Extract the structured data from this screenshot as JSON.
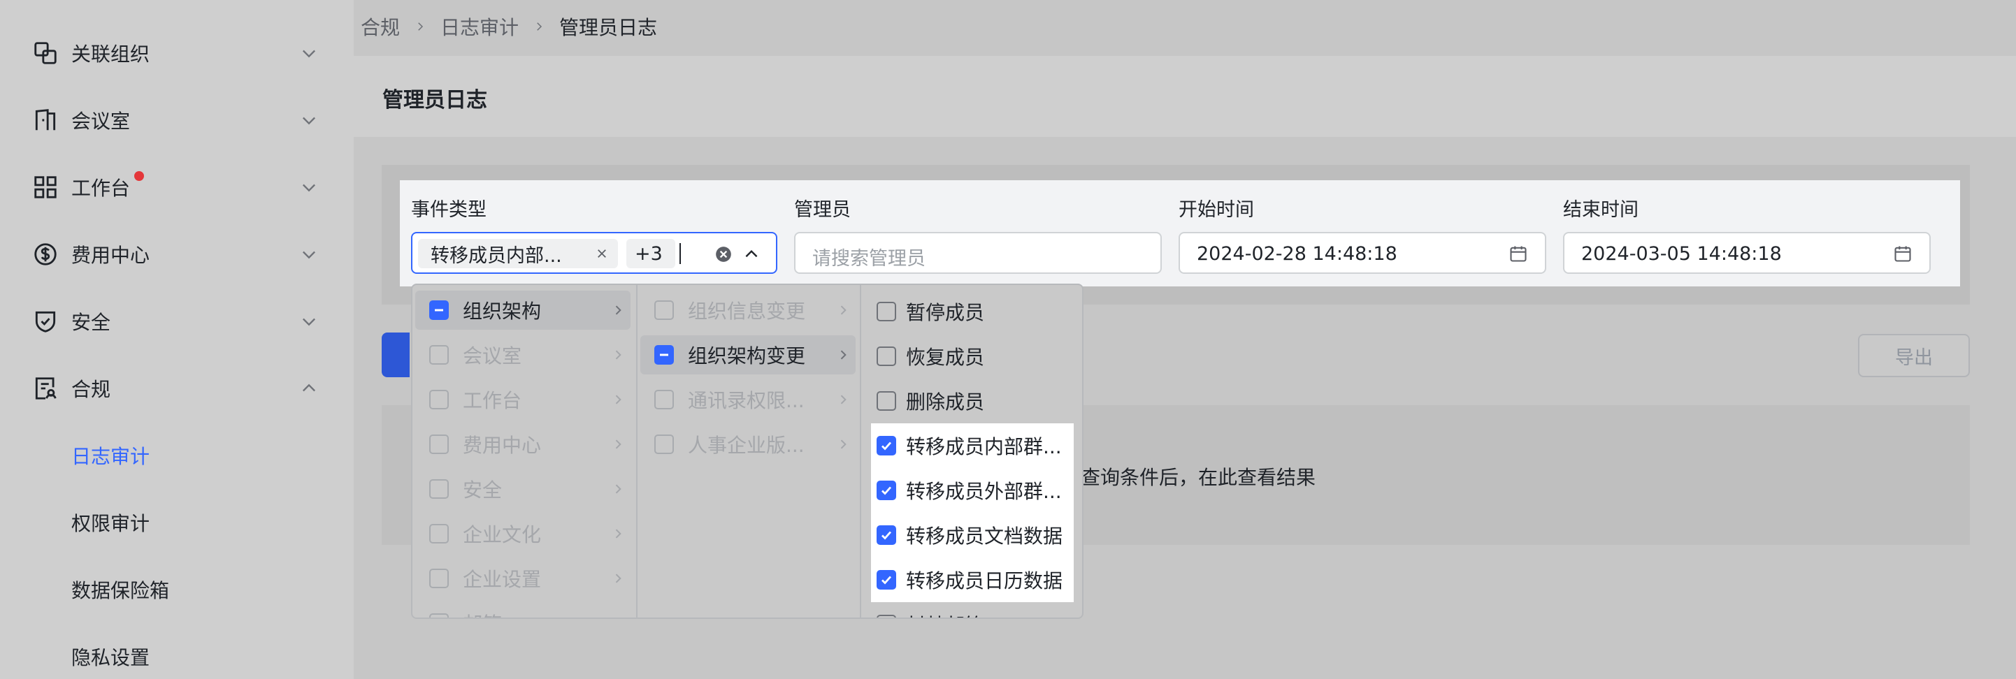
{
  "sidebar": {
    "items": [
      {
        "label": "关联组织",
        "icon": "link-org-icon"
      },
      {
        "label": "会议室",
        "icon": "meeting-room-icon"
      },
      {
        "label": "工作台",
        "icon": "grid-icon"
      },
      {
        "label": "费用中心",
        "icon": "dollar-icon"
      },
      {
        "label": "安全",
        "icon": "shield-icon"
      },
      {
        "label": "合规",
        "icon": "compliance-icon"
      }
    ],
    "sub_items": [
      "日志审计",
      "权限审计",
      "数据保险箱",
      "隐私设置"
    ]
  },
  "breadcrumb": {
    "items": [
      "合规",
      "日志审计",
      "管理员日志"
    ]
  },
  "page_title": "管理员日志",
  "filters": {
    "event_type_label": "事件类型",
    "event_type_tag": "转移成员内部...",
    "event_type_more": "+3",
    "admin_label": "管理员",
    "admin_placeholder": "请搜索管理员",
    "start_label": "开始时间",
    "start_value": "2024-02-28 14:48:18",
    "end_label": "结束时间",
    "end_value": "2024-03-05 14:48:18"
  },
  "export_label": "导出",
  "empty_text": "查询条件后，在此查看结果",
  "dropdown": {
    "col1": [
      "组织架构",
      "会议室",
      "工作台",
      "费用中心",
      "安全",
      "企业文化",
      "企业设置",
      "邮箱"
    ],
    "col2": [
      "组织信息变更",
      "组织架构变更",
      "通讯录权限...",
      "人事企业版..."
    ],
    "col3": [
      "暂停成员",
      "恢复成员",
      "删除成员",
      "转移成员内部群...",
      "转移成员外部群...",
      "转移成员文档数据",
      "转移成员日历数据",
      "封禁邮箱"
    ]
  },
  "colors": {
    "accent": "#3366ff",
    "badge": "#e4373a"
  }
}
